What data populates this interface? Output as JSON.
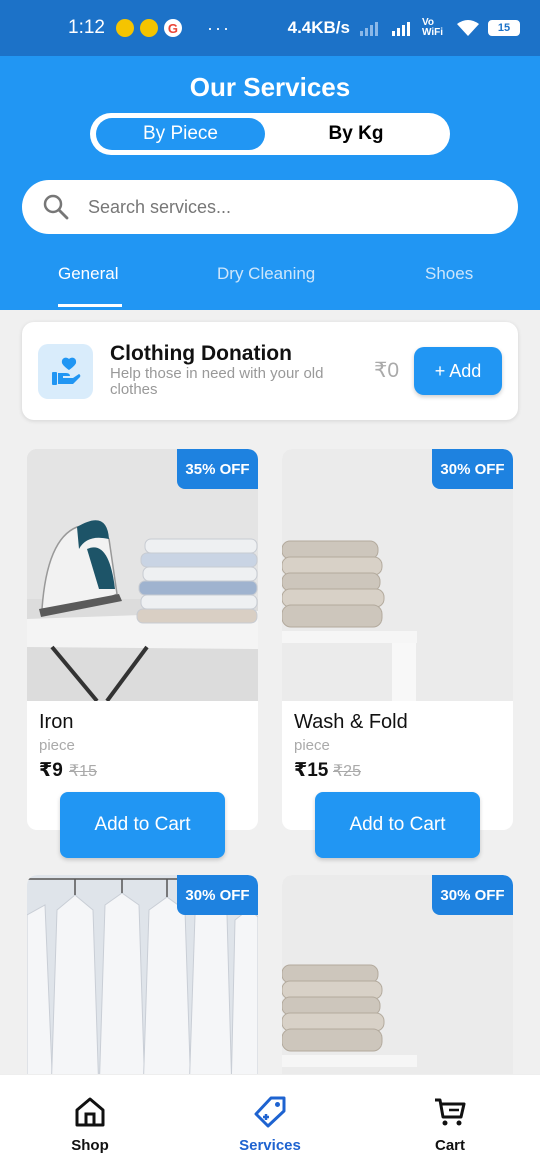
{
  "status_bar": {
    "time": "1:12",
    "more": "···",
    "network_speed": "4.4KB/s",
    "vowifi": "Vo WiFi",
    "battery": "15"
  },
  "header": {
    "title": "Our Services",
    "segment": {
      "active": "By Piece",
      "inactive": "By Kg"
    },
    "search_placeholder": "Search services...",
    "tabs": [
      {
        "label": "General",
        "active": true
      },
      {
        "label": "Dry Cleaning",
        "active": false
      },
      {
        "label": "Shoes",
        "active": false
      }
    ]
  },
  "donation": {
    "title": "Clothing Donation",
    "description": "Help those in need with your old clothes",
    "price": "₹0",
    "add_label": "+ Add"
  },
  "products": [
    {
      "name": "Iron",
      "unit": "piece",
      "price": "₹9",
      "old_price": "₹15",
      "discount": "35% OFF",
      "button": "Add to Cart",
      "image": "iron-on-board-with-folded-shirts"
    },
    {
      "name": "Wash & Fold",
      "unit": "piece",
      "price": "₹15",
      "old_price": "₹25",
      "discount": "30% OFF",
      "button": "Add to Cart",
      "image": "folded-towels-stack"
    },
    {
      "discount": "30% OFF",
      "image": "white-shirts-on-hangers"
    },
    {
      "discount": "30% OFF",
      "image": "folded-towels-stack"
    }
  ],
  "bottom_nav": [
    {
      "label": "Shop",
      "icon": "home-icon",
      "active": false
    },
    {
      "label": "Services",
      "icon": "tag-icon",
      "active": true
    },
    {
      "label": "Cart",
      "icon": "cart-icon",
      "active": false
    }
  ],
  "colors": {
    "primary": "#2196f3",
    "status_bar": "#1c72c8",
    "badge": "#1e82e0",
    "active_nav": "#1e63d0"
  }
}
